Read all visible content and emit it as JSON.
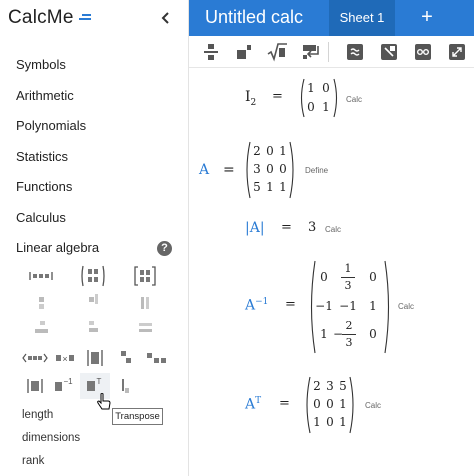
{
  "app": {
    "logo": "CalcMe",
    "title": "Untitled calc",
    "tab": "Sheet 1",
    "add_tab": "+"
  },
  "sidebar": {
    "collapse": "‹",
    "menu": [
      "Symbols",
      "Arithmetic",
      "Polynomials",
      "Statistics",
      "Functions",
      "Calculus",
      "Linear algebra"
    ],
    "help": "?",
    "functions": [
      "length",
      "dimensions",
      "rank"
    ],
    "tooltip": "Transpose"
  },
  "toolbar": {
    "tools": [
      "fraction-icon",
      "power-icon",
      "root-icon",
      "return-icon",
      "approximate-icon",
      "clear-icon",
      "link-icon",
      "expand-icon"
    ]
  },
  "sheet": {
    "rows": [
      {
        "lhs": "I",
        "sub": "2",
        "op": "=",
        "matrix": [
          [
            "1",
            "0"
          ],
          [
            "0",
            "1"
          ]
        ],
        "tag": "Calc"
      },
      {
        "lhs": "A",
        "op": "=",
        "matrix": [
          [
            "2",
            "0",
            "1"
          ],
          [
            "3",
            "0",
            "0"
          ],
          [
            "5",
            "1",
            "1"
          ]
        ],
        "tag": "Define"
      },
      {
        "lhs": "|A|",
        "op": "=",
        "result": "3",
        "tag": "Calc"
      },
      {
        "lhs": "A",
        "sup": "−1",
        "op": "=",
        "matrix": [
          [
            "0",
            "1/3",
            "0"
          ],
          [
            "−1",
            "−1",
            "1"
          ],
          [
            "1",
            "−2/3",
            "0"
          ]
        ],
        "tag": "Calc"
      },
      {
        "lhs": "A",
        "sup": "T",
        "op": "=",
        "matrix": [
          [
            "2",
            "3",
            "5"
          ],
          [
            "0",
            "0",
            "1"
          ],
          [
            "1",
            "0",
            "1"
          ]
        ],
        "tag": "Calc"
      }
    ]
  },
  "colors": {
    "accent": "#2a7bd4",
    "tab_active": "#1f6ab8"
  }
}
